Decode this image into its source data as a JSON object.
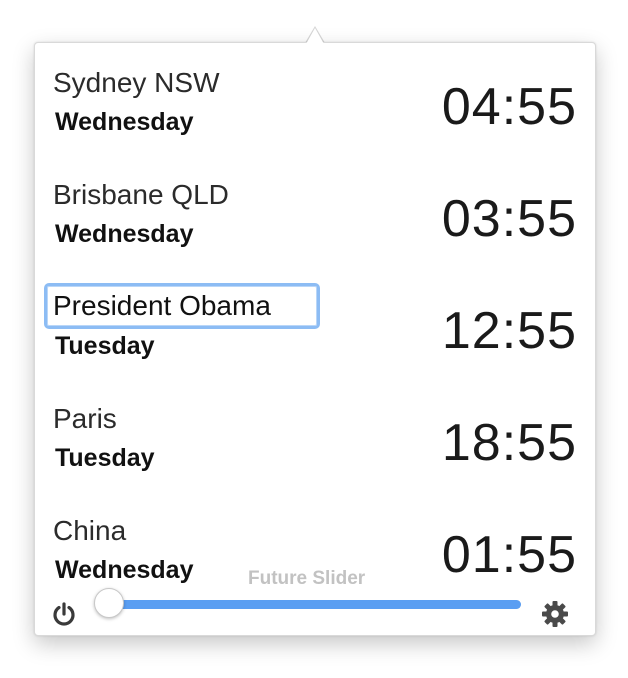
{
  "clocks": [
    {
      "city": "Sydney NSW",
      "day": "Wednesday",
      "time": "04:55"
    },
    {
      "city": "Brisbane QLD",
      "day": "Wednesday",
      "time": "03:55"
    },
    {
      "city": "President Obama",
      "day": "Tuesday",
      "time": "12:55",
      "editing": true
    },
    {
      "city": "Paris",
      "day": "Tuesday",
      "time": "18:55"
    },
    {
      "city": "China",
      "day": "Wednesday",
      "time": "01:55"
    }
  ],
  "footer": {
    "slider_label": "Future Slider",
    "slider_value": 0,
    "power_icon": "power-icon",
    "settings_icon": "gear-icon"
  },
  "colors": {
    "accent": "#5a9ef2",
    "focus_ring": "#8cbcf4",
    "label_muted": "#c2c2c2"
  }
}
